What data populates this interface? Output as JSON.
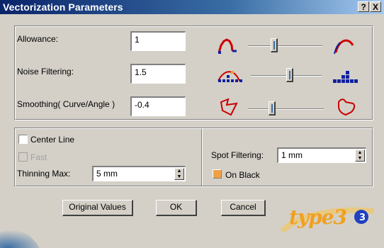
{
  "window": {
    "title": "Vectorization Parameters",
    "help_glyph": "?",
    "close_glyph": "X"
  },
  "parameters": {
    "allowance": {
      "label": "Allowance:",
      "value": "1",
      "slider_position": 0.35
    },
    "noise_filtering": {
      "label": "Noise Filtering:",
      "value": "1.5",
      "slider_position": 0.55
    },
    "smoothing": {
      "label": "Smoothing( Curve/Angle )",
      "value": "-0.4",
      "slider_position": 0.32
    }
  },
  "options": {
    "center_line": {
      "label": "Center Line",
      "checked": false
    },
    "fast": {
      "label": "Fast",
      "checked": false,
      "enabled": false
    },
    "thinning_max": {
      "label": "Thinning Max:",
      "value": "5 mm"
    },
    "spot_filtering": {
      "label": "Spot Filtering:",
      "value": "1 mm"
    },
    "on_black": {
      "label": "On Black",
      "checked": true
    }
  },
  "buttons": {
    "original_values": "Original Values",
    "ok": "OK",
    "cancel": "Cancel"
  },
  "logo": {
    "text": "type3"
  },
  "icons": {
    "allowance_min": "sharp-curve-icon",
    "allowance_max": "smooth-curve-icon",
    "noise_min": "dotted-peak-icon",
    "noise_max": "block-histogram-icon",
    "smoothing_min": "angular-shape-icon",
    "smoothing_max": "rounded-shape-icon"
  },
  "colors": {
    "icon_red": "#cc0000",
    "icon_blue": "#1020a0",
    "logo_orange": "#f0a020",
    "logo_blue": "#2040c0"
  }
}
